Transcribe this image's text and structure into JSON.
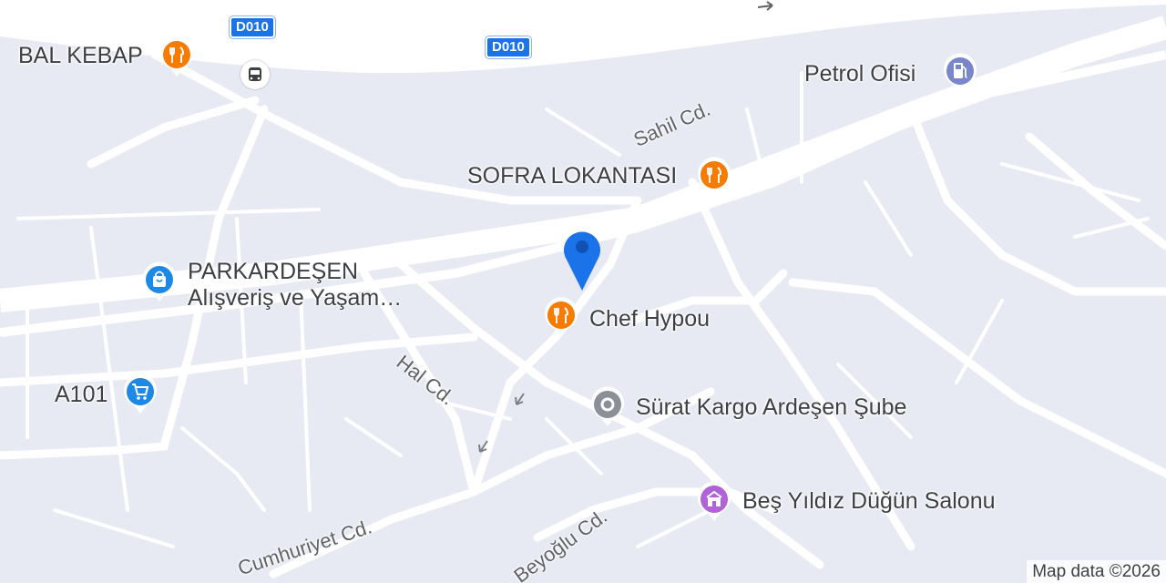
{
  "map": {
    "highway_shields": [
      "D010",
      "D010"
    ],
    "pois": [
      {
        "name": "BAL KEBAP",
        "category": "restaurant",
        "icon": "fork-knife-icon",
        "color": "#f57c00"
      },
      {
        "name": "Petrol Ofisi",
        "category": "gas-station",
        "icon": "fuel-pump-icon",
        "color": "#7986cb"
      },
      {
        "name": "SOFRA LOKANTASI",
        "category": "restaurant",
        "icon": "fork-knife-icon",
        "color": "#f57c00"
      },
      {
        "name": "PARKARDEŞEN",
        "name_line2": "Alışveriş ve Yaşam…",
        "category": "shopping",
        "icon": "shopping-bag-icon",
        "color": "#1e88e5"
      },
      {
        "name": "Chef Hypou",
        "category": "restaurant",
        "icon": "fork-knife-icon",
        "color": "#f57c00"
      },
      {
        "name": "A101",
        "category": "supermarket",
        "icon": "shopping-cart-icon",
        "color": "#1e88e5"
      },
      {
        "name": "Sürat Kargo Ardeşen Şube",
        "category": "place",
        "icon": "place-dot-icon",
        "color": "#8a8f98"
      },
      {
        "name": "Beş Yıldız Düğün Salonu",
        "category": "event-venue",
        "icon": "venue-icon",
        "color": "#b062d8"
      }
    ],
    "streets": [
      "Sahil Cd.",
      "Hal Cd.",
      "Cumhuriyet Cd.",
      "Beyoğlu Cd."
    ],
    "transit_icon": "bus-stop-icon",
    "location_marker_color": "#1a73e8",
    "attribution": "Map data ©2026"
  }
}
